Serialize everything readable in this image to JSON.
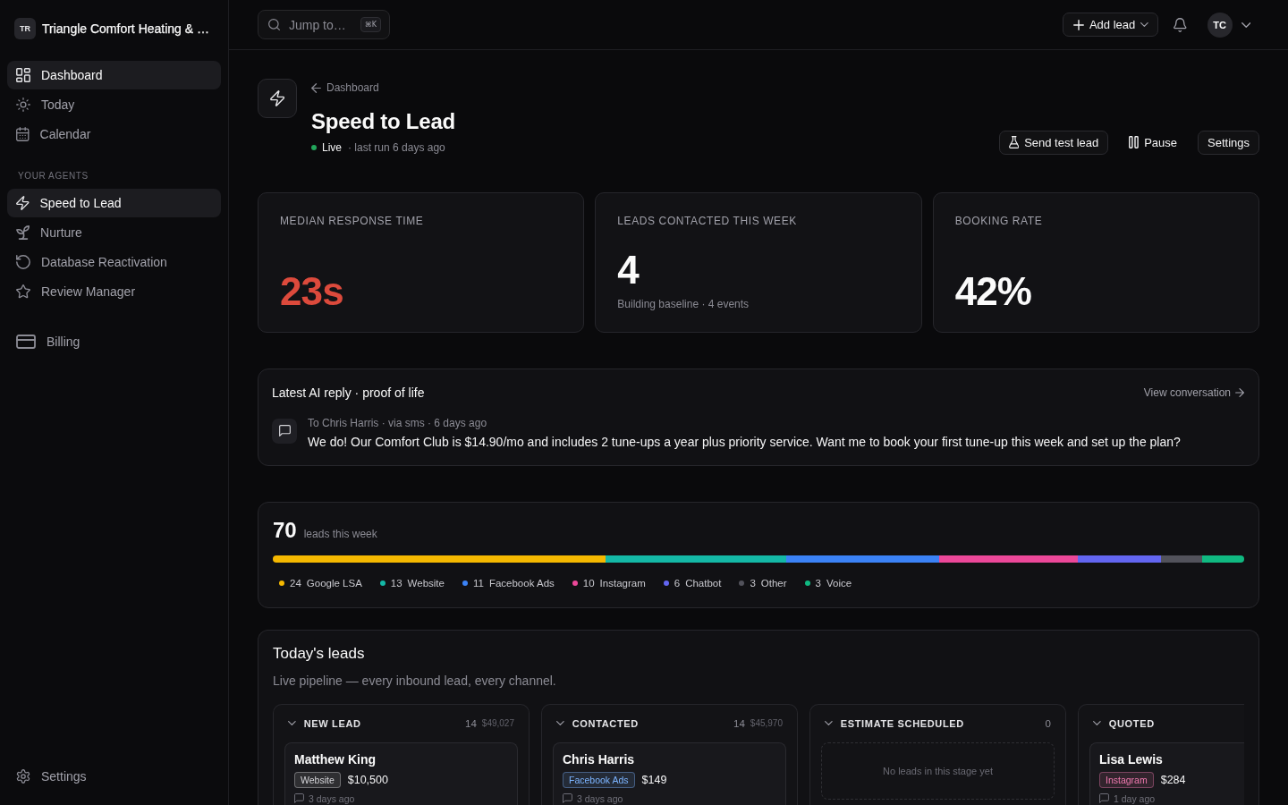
{
  "sidebar": {
    "brand": {
      "initials": "TR",
      "name": "Triangle Comfort Heating & …"
    },
    "nav": [
      {
        "label": "Dashboard",
        "selected": true
      },
      {
        "label": "Today",
        "selected": false
      },
      {
        "label": "Calendar",
        "selected": false
      }
    ],
    "agents": {
      "heading": "YOUR AGENTS",
      "items": [
        {
          "label": "Speed to Lead",
          "selected": true
        },
        {
          "label": "Nurture",
          "selected": false
        },
        {
          "label": "Database Reactivation",
          "selected": false
        },
        {
          "label": "Review Manager",
          "selected": false
        }
      ]
    },
    "more": [
      {
        "label": "Billing",
        "selected": false
      }
    ],
    "footer": [
      {
        "label": "Settings",
        "selected": false
      }
    ]
  },
  "topbar": {
    "search": {
      "placeholder": "Jump to…",
      "shortcut": "⌘K"
    },
    "add_button": "Add lead",
    "avatar": "TC"
  },
  "header": {
    "breadcrumb": "Dashboard",
    "title": "Speed to Lead",
    "status": {
      "label": "Live",
      "live": true
    },
    "last_run": "· last run 6 days ago",
    "actions": [
      {
        "label": "Send test lead",
        "kind": "outline"
      },
      {
        "label": "Pause",
        "kind": "ghost"
      },
      {
        "label": "Settings",
        "kind": "outline"
      }
    ]
  },
  "stats": [
    {
      "label": "MEDIAN RESPONSE TIME",
      "value": "23s",
      "alert": true
    },
    {
      "label": "LEADS CONTACTED THIS WEEK",
      "value": "4",
      "note": "Building baseline · 4 events",
      "alert": false
    },
    {
      "label": "BOOKING RATE",
      "value": "42%",
      "alert": false
    }
  ],
  "latest_reply": {
    "title": "Latest AI reply · proof of life",
    "link": "View conversation",
    "meta": "To Chris Harris · via sms · 6 days ago",
    "message": "We do! Our Comfort Club is $14.90/mo and includes 2 tune-ups a year plus priority service. Want me to book your first tune-up this week and set up the plan?"
  },
  "lead_sources": {
    "total": "70",
    "total_label": "leads this week",
    "items": [
      {
        "count": "24",
        "label": "Google LSA",
        "color": "#f5b800"
      },
      {
        "count": "13",
        "label": "Website",
        "color": "#14b8a6"
      },
      {
        "count": "11",
        "label": "Facebook Ads",
        "color": "#3b82f6"
      },
      {
        "count": "10",
        "label": "Instagram",
        "color": "#ec4899"
      },
      {
        "count": "6",
        "label": "Chatbot",
        "color": "#6366f1"
      },
      {
        "count": "3",
        "label": "Other",
        "color": "#52525b"
      },
      {
        "count": "3",
        "label": "Voice",
        "color": "#10b981"
      }
    ]
  },
  "pipeline": {
    "title": "Today's leads",
    "subtitle": "Live pipeline — every inbound lead, every channel.",
    "columns": [
      {
        "name": "NEW LEAD",
        "count": "14",
        "value": "$49,027",
        "leads": [
          {
            "name": "Matthew King",
            "source": "Website",
            "color": "#d4d4d8",
            "amount": "$10,500",
            "age": "3 days ago"
          }
        ]
      },
      {
        "name": "CONTACTED",
        "count": "14",
        "value": "$45,970",
        "leads": [
          {
            "name": "Chris Harris",
            "source": "Facebook Ads",
            "color": "#7cb4ff",
            "amount": "$149",
            "age": "3 days ago"
          }
        ]
      },
      {
        "name": "ESTIMATE SCHEDULED",
        "count": "0",
        "empty": "No leads in this stage yet"
      },
      {
        "name": "QUOTED",
        "leads": [
          {
            "name": "Lisa Lewis",
            "source": "Instagram",
            "color": "#f07ab0",
            "amount": "$284",
            "age": "1 day ago"
          }
        ]
      }
    ]
  }
}
